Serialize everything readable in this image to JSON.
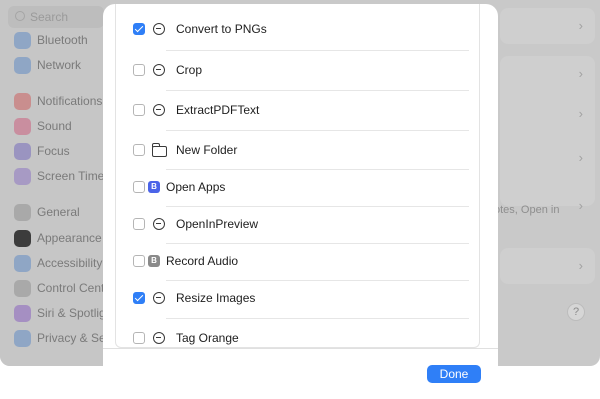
{
  "background": {
    "search_placeholder": "Search",
    "sidebar": [
      {
        "label": "Bluetooth",
        "icon": "bluetooth-icon",
        "color": "#8fa6c5"
      },
      {
        "label": "Network",
        "icon": "globe-icon",
        "color": "#8fa6c5"
      },
      {
        "label": "Notifications",
        "icon": "bell-icon",
        "color": "#c98e8e"
      },
      {
        "label": "Sound",
        "icon": "speaker-icon",
        "color": "#c98e9f"
      },
      {
        "label": "Focus",
        "icon": "moon-icon",
        "color": "#9a94c0"
      },
      {
        "label": "Screen Time",
        "icon": "hourglass-icon",
        "color": "#a79ac4"
      },
      {
        "label": "General",
        "icon": "gear-icon",
        "color": "#a9a9a9"
      },
      {
        "label": "Appearance",
        "icon": "appearance-icon",
        "color": "#3c3c3c"
      },
      {
        "label": "Accessibility",
        "icon": "accessibility-icon",
        "color": "#8fa6c5"
      },
      {
        "label": "Control Cente",
        "icon": "control-center-icon",
        "color": "#a9a9a9"
      },
      {
        "label": "Siri & Spotligh",
        "icon": "siri-icon",
        "color": "#a58fc2"
      },
      {
        "label": "Privacy & Sec",
        "icon": "hand-icon",
        "color": "#8fa6c5"
      }
    ],
    "truncated_text": "otes, Open in",
    "help_label": "?"
  },
  "sheet": {
    "items": [
      {
        "label": "Convert to PNGs",
        "checked": true,
        "icon": "shortcut-dots-icon"
      },
      {
        "label": "Crop",
        "checked": false,
        "icon": "shortcut-dots-icon"
      },
      {
        "label": "ExtractPDFText",
        "checked": false,
        "icon": "shortcut-dots-icon"
      },
      {
        "label": "New Folder",
        "checked": false,
        "icon": "folder-icon"
      },
      {
        "label": "Open Apps",
        "checked": false,
        "icon": "app-blue-icon",
        "icon_color": "#4b64e8",
        "icon_glyph": "B"
      },
      {
        "label": "OpenInPreview",
        "checked": false,
        "icon": "shortcut-dots-icon"
      },
      {
        "label": "Record Audio",
        "checked": false,
        "icon": "app-gray-icon",
        "icon_color": "#8a8a8a",
        "icon_glyph": "B"
      },
      {
        "label": "Resize Images",
        "checked": true,
        "icon": "shortcut-dots-icon"
      },
      {
        "label": "Tag Orange",
        "checked": false,
        "icon": "shortcut-dots-icon"
      }
    ],
    "done_label": "Done",
    "accent_color": "#2f7ff7"
  }
}
